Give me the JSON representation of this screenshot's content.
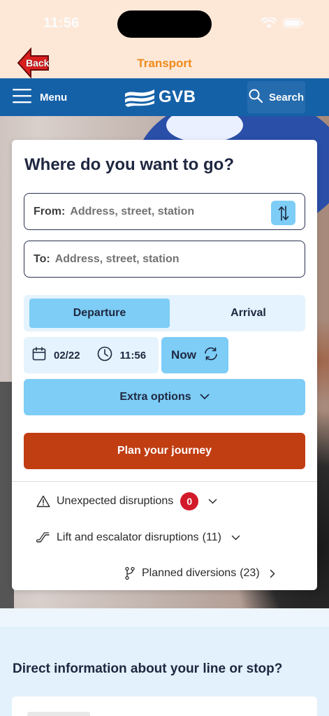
{
  "status_bar": {
    "time": "11:56"
  },
  "app_bar": {
    "back_label": "Back",
    "title": "Transport"
  },
  "header": {
    "menu_label": "Menu",
    "logo_text": "GVB",
    "search_label": "Search"
  },
  "planner": {
    "title": "Where do you want to go?",
    "from": {
      "label": "From:",
      "placeholder": "Address, street, station"
    },
    "to": {
      "label": "To:",
      "placeholder": "Address, street, station"
    },
    "mode": {
      "departure": "Departure",
      "arrival": "Arrival",
      "selected": "departure"
    },
    "date": "02/22",
    "time": "11:56",
    "now_label": "Now",
    "extra_options_label": "Extra options",
    "plan_label": "Plan your journey"
  },
  "disruptions": {
    "unexpected": {
      "label": "Unexpected disruptions",
      "count": "0"
    },
    "lift": {
      "label": "Lift and escalator disruptions",
      "count": "(11)"
    },
    "planned": {
      "label": "Planned diversions",
      "count": "(23)"
    }
  },
  "info": {
    "title": "Direct information about your line or stop?"
  },
  "colors": {
    "app_bar_bg": "#fde8d8",
    "app_title": "#f08a1a",
    "header_bg": "#1561a8",
    "accent_light": "#7dcdf6",
    "accent_bg": "#e4f3fd",
    "plan_button": "#c13d12",
    "badge": "#d21a2a"
  }
}
